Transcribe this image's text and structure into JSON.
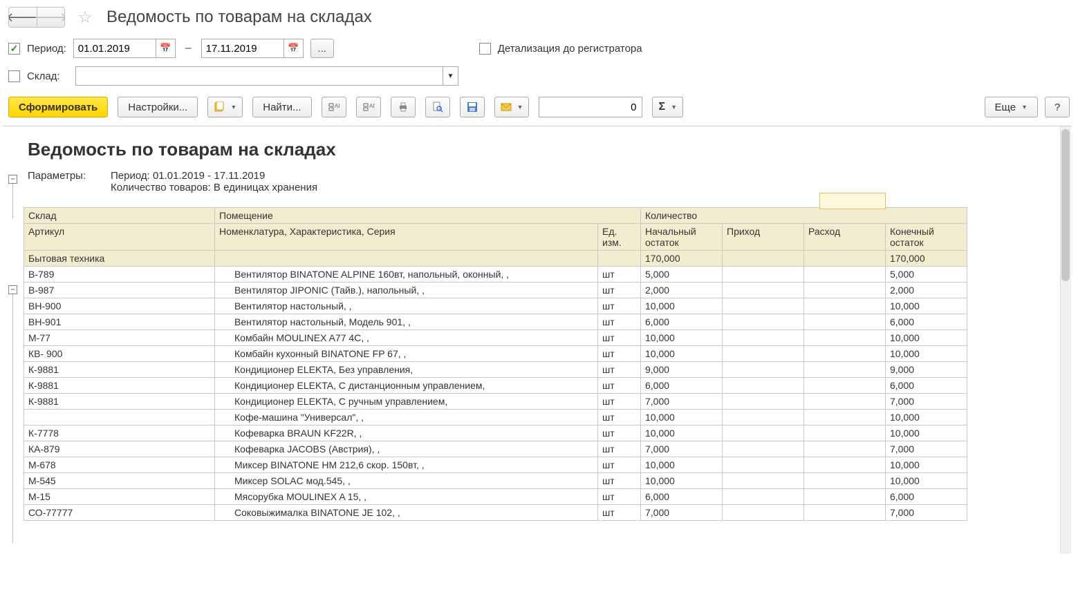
{
  "title": "Ведомость по товарам на складах",
  "filters": {
    "period_label": "Период:",
    "date_from": "01.01.2019",
    "date_to": "17.11.2019",
    "ellipsis": "...",
    "detail_label": "Детализация до регистратора",
    "warehouse_label": "Склад:",
    "warehouse_value": ""
  },
  "toolbar": {
    "generate": "Сформировать",
    "settings": "Настройки...",
    "find": "Найти...",
    "num_value": "0",
    "sigma": "Σ",
    "more": "Еще",
    "help": "?"
  },
  "report": {
    "title": "Ведомость по товарам на складах",
    "params_label": "Параметры:",
    "param_period": "Период: 01.01.2019 - 17.11.2019",
    "param_qty": "Количество товаров: В единицах хранения",
    "headers": {
      "warehouse": "Склад",
      "room": "Помещение",
      "qty": "Количество",
      "article": "Артикул",
      "nomen": "Номенклатура, Характеристика, Серия",
      "unit": "Ед. изм.",
      "start": "Начальный остаток",
      "income": "Приход",
      "expense": "Расход",
      "end": "Конечный остаток"
    },
    "group": {
      "name": "Бытовая техника",
      "start": "170,000",
      "end": "170,000"
    },
    "rows": [
      {
        "art": "В-789",
        "nomen": "Вентилятор BINATONE ALPINE 160вт, напольный, оконный, ,",
        "unit": "шт",
        "start": "5,000",
        "end": "5,000"
      },
      {
        "art": "В-987",
        "nomen": "Вентилятор JIPONIC (Тайв.), напольный, ,",
        "unit": "шт",
        "start": "2,000",
        "end": "2,000"
      },
      {
        "art": "ВН-900",
        "nomen": "Вентилятор настольный, ,",
        "unit": "шт",
        "start": "10,000",
        "end": "10,000"
      },
      {
        "art": "ВН-901",
        "nomen": "Вентилятор настольный, Модель 901, ,",
        "unit": "шт",
        "start": "6,000",
        "end": "6,000"
      },
      {
        "art": "М-77",
        "nomen": "Комбайн MOULINEX  A77 4C, ,",
        "unit": "шт",
        "start": "10,000",
        "end": "10,000"
      },
      {
        "art": "КВ- 900",
        "nomen": "Комбайн кухонный BINATONE FP 67, ,",
        "unit": "шт",
        "start": "10,000",
        "end": "10,000"
      },
      {
        "art": "К-9881",
        "nomen": "Кондиционер ELEKTA, Без управления,",
        "unit": "шт",
        "start": "9,000",
        "end": "9,000"
      },
      {
        "art": "К-9881",
        "nomen": "Кондиционер ELEKTA, С дистанционным управлением,",
        "unit": "шт",
        "start": "6,000",
        "end": "6,000"
      },
      {
        "art": "К-9881",
        "nomen": "Кондиционер ELEKTA, С ручным управлением,",
        "unit": "шт",
        "start": "7,000",
        "end": "7,000"
      },
      {
        "art": "",
        "nomen": "Кофе-машина \"Универсал\", ,",
        "unit": "шт",
        "start": "10,000",
        "end": "10,000"
      },
      {
        "art": "К-7778",
        "nomen": "Кофеварка BRAUN KF22R, ,",
        "unit": "шт",
        "start": "10,000",
        "end": "10,000"
      },
      {
        "art": "КА-879",
        "nomen": "Кофеварка JACOBS (Австрия), ,",
        "unit": "шт",
        "start": "7,000",
        "end": "7,000"
      },
      {
        "art": "М-678",
        "nomen": "Миксер BINATONE HM 212,6 скор. 150вт, ,",
        "unit": "шт",
        "start": "10,000",
        "end": "10,000"
      },
      {
        "art": "М-545",
        "nomen": "Миксер SOLAC мод.545, ,",
        "unit": "шт",
        "start": "10,000",
        "end": "10,000"
      },
      {
        "art": "М-15",
        "nomen": "Мясорубка MOULINEX  A 15, ,",
        "unit": "шт",
        "start": "6,000",
        "end": "6,000"
      },
      {
        "art": "СО-77777",
        "nomen": "Соковыжималка  BINATONE JE 102, ,",
        "unit": "шт",
        "start": "7,000",
        "end": "7,000"
      }
    ]
  }
}
